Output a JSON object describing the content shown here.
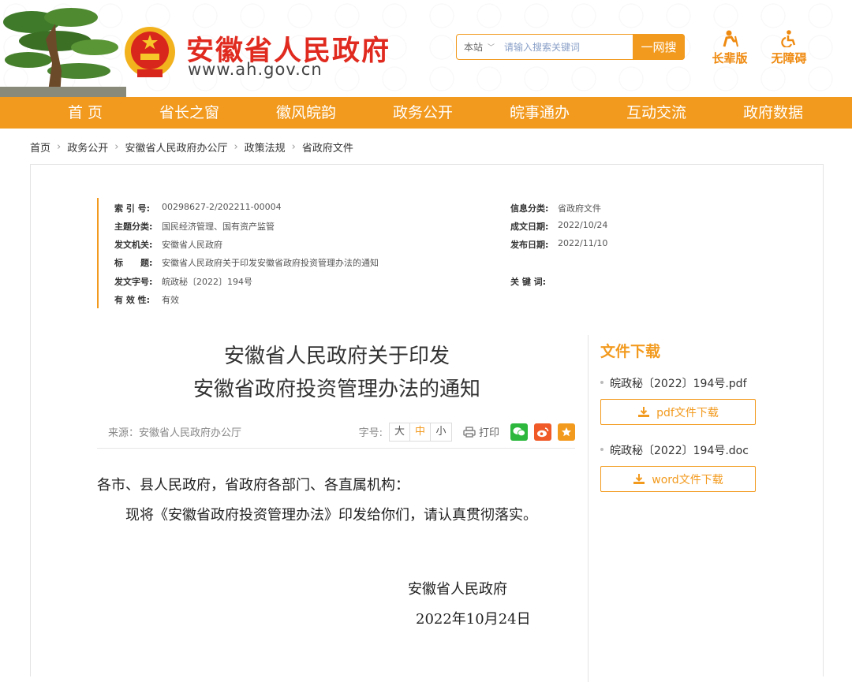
{
  "header": {
    "site_name": "安徽省人民政府",
    "site_url": "www.ah.gov.cn",
    "search": {
      "scope": "本站",
      "placeholder": "请输入搜索关键词",
      "button": "一网搜"
    },
    "tools": {
      "elder": "长辈版",
      "accessible": "无障碍"
    }
  },
  "nav": [
    "首 页",
    "省长之窗",
    "徽风皖韵",
    "政务公开",
    "皖事通办",
    "互动交流",
    "政府数据"
  ],
  "breadcrumb": [
    "首页",
    "政务公开",
    "安徽省人民政府办公厅",
    "政策法规",
    "省政府文件"
  ],
  "meta": {
    "index_label": "索 引 号:",
    "index_value": "00298627-2/202211-00004",
    "topic_label": "主题分类:",
    "topic_value": "国民经济管理、国有资产监管",
    "issuer_label": "发文机关:",
    "issuer_value": "安徽省人民政府",
    "title_label": "标　　题:",
    "title_value": "安徽省人民政府关于印发安徽省政府投资管理办法的通知",
    "docno_label": "发文字号:",
    "docno_value": "皖政秘〔2022〕194号",
    "valid_label": "有 效 性:",
    "valid_value": "有效",
    "category_label": "信息分类:",
    "category_value": "省政府文件",
    "created_label": "成文日期:",
    "created_value": "2022/10/24",
    "published_label": "发布日期:",
    "published_value": "2022/11/10",
    "keywords_label": "关 键 词:",
    "keywords_value": ""
  },
  "article": {
    "title_line1": "安徽省人民政府关于印发",
    "title_line2": "安徽省政府投资管理办法的通知",
    "source": "来源：安徽省人民政府办公厅",
    "font_label": "字号:",
    "font_sizes": [
      "大",
      "中",
      "小"
    ],
    "print": "打印",
    "salutation": "各市、县人民政府，省政府各部门、各直属机构：",
    "paragraph": "现将《安徽省政府投资管理办法》印发给你们，请认真贯彻落实。",
    "signer": "安徽省人民政府",
    "date": "2022年10月24日"
  },
  "downloads": {
    "heading": "文件下载",
    "files": [
      {
        "name": "皖政秘〔2022〕194号.pdf",
        "button": "pdf文件下载"
      },
      {
        "name": "皖政秘〔2022〕194号.doc",
        "button": "word文件下载"
      }
    ]
  },
  "colors": {
    "accent": "#f29a1e",
    "brand_red": "#e02a1f",
    "wechat": "#2db83d",
    "weibo": "#ef5a28"
  }
}
